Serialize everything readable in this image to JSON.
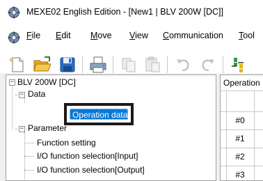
{
  "window": {
    "title": "MEXE02 English Edition - [New1 | BLV 200W [DC]]"
  },
  "menu": {
    "items": [
      {
        "underline": "F",
        "rest": "ile"
      },
      {
        "underline": "E",
        "rest": "dit"
      },
      {
        "underline": "M",
        "rest": "ove"
      },
      {
        "underline": "V",
        "rest": "iew"
      },
      {
        "underline": "C",
        "rest": "ommunication"
      },
      {
        "underline": "T",
        "rest": "ool"
      }
    ]
  },
  "toolbar": {
    "buttons": [
      "new-file-icon",
      "open-folder-icon",
      "save-icon",
      "print-icon",
      "copy-icon",
      "paste-icon",
      "undo-icon",
      "redo-icon",
      "connect-icon"
    ]
  },
  "tree": {
    "root": "BLV 200W [DC]",
    "data_node": "Data",
    "operation_data": "Operation data",
    "parameter_node": "Parameter",
    "function_setting": "Function setting",
    "io_input": "I/O function selection[Input]",
    "io_output": "I/O function selection[Output]"
  },
  "right_panel": {
    "tab_label": "Operation",
    "rows": [
      "#0",
      "#1",
      "#2",
      "#3"
    ]
  },
  "colors": {
    "selection": "#0a78d7",
    "highlight_border": "#1a1a1a"
  }
}
